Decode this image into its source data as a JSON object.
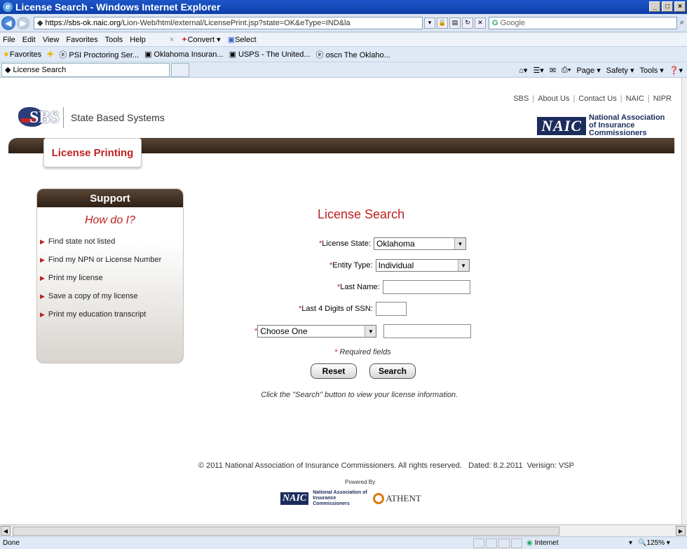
{
  "browser": {
    "title": "License Search - Windows Internet Explorer",
    "url_host": "https://sbs-ok.naic.org",
    "url_path": "/Lion-Web/html/external/LicensePrint.jsp?state=OK&eType=IND&la",
    "search_placeholder": "Google",
    "menu": [
      "File",
      "Edit",
      "View",
      "Favorites",
      "Tools",
      "Help"
    ],
    "convert_label": "Convert",
    "select_label": "Select",
    "favorites_label": "Favorites",
    "fav_links": [
      "PSI Proctoring Ser...",
      "Oklahoma Insuran...",
      "USPS - The United...",
      "oscn The Oklaho..."
    ],
    "tab_title": "License Search",
    "cmd": [
      "Page",
      "Safety",
      "Tools"
    ],
    "status_text": "Done",
    "zone": "Internet",
    "zoom": "125%"
  },
  "header": {
    "links": [
      "SBS",
      "About Us",
      "Contact Us",
      "NAIC",
      "NIPR"
    ],
    "sbs_logo_text": "SBS",
    "sbs_name": "State Based Systems",
    "naic_abbr": "NAIC",
    "naic_full": "National Association of Insurance Commissioners",
    "section_tab": "License Printing"
  },
  "support": {
    "heading": "Support",
    "subheading": "How do I?",
    "items": [
      "Find state not listed",
      "Find my NPN or License Number",
      "Print my license",
      "Save a copy of my license",
      "Print my education transcript"
    ]
  },
  "form": {
    "title": "License Search",
    "state_label": "License State:",
    "state_value": "Oklahoma",
    "entity_label": "Entity Type:",
    "entity_value": "Individual",
    "last_name_label": "Last Name:",
    "ssn_label": "Last 4 Digits of SSN:",
    "id_type_value": "Choose One",
    "required_note": "Required fields",
    "reset_label": "Reset",
    "search_label": "Search",
    "hint": "Click the \"Search\" button to view your license information."
  },
  "footer": {
    "copyright": "© 2011 National Association of Insurance Commissioners. All rights reserved.   Dated: 8.2.2011  Verisign: VSP",
    "powered_by": "Powered By",
    "naic_abbr": "NAIC",
    "naic_full": "National Association of Insurance Commissioners",
    "athent": "ATHENT"
  }
}
